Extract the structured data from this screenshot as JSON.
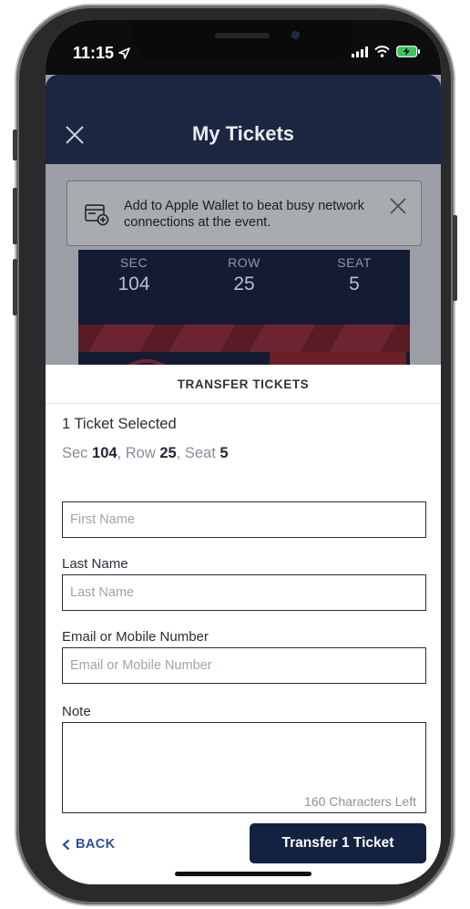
{
  "status_bar": {
    "time": "11:15"
  },
  "header": {
    "title": "My Tickets"
  },
  "wallet_banner": {
    "text": "Add to Apple Wallet to beat busy network connections at the event."
  },
  "ticket": {
    "sec_label": "SEC",
    "sec_value": "104",
    "row_label": "ROW",
    "row_value": "25",
    "seat_label": "SEAT",
    "seat_value": "5"
  },
  "sheet": {
    "title": "TRANSFER TICKETS",
    "selected_text": "1 Ticket Selected",
    "seat_summary": {
      "sec_prefix": "Sec ",
      "sec": "104",
      "row_prefix": ", Row ",
      "row": "25",
      "seat_prefix": ", Seat ",
      "seat": "5"
    },
    "first_name": {
      "placeholder": "First Name",
      "value": ""
    },
    "last_name": {
      "label": "Last Name",
      "placeholder": "Last Name",
      "value": ""
    },
    "contact": {
      "label": "Email or Mobile Number",
      "placeholder": "Email or Mobile Number",
      "value": ""
    },
    "note": {
      "label": "Note",
      "value": "",
      "chars_left": "160 Characters Left"
    },
    "back_label": "BACK",
    "transfer_label": "Transfer 1 Ticket"
  },
  "icons": [
    "location-arrow-icon",
    "close-icon",
    "wallet-add-icon",
    "signal-icon",
    "wifi-icon",
    "battery-charging-icon",
    "chevron-left-icon"
  ],
  "colors": {
    "primary": "#132241",
    "link": "#2b4f9e",
    "header": "#1c2640"
  }
}
